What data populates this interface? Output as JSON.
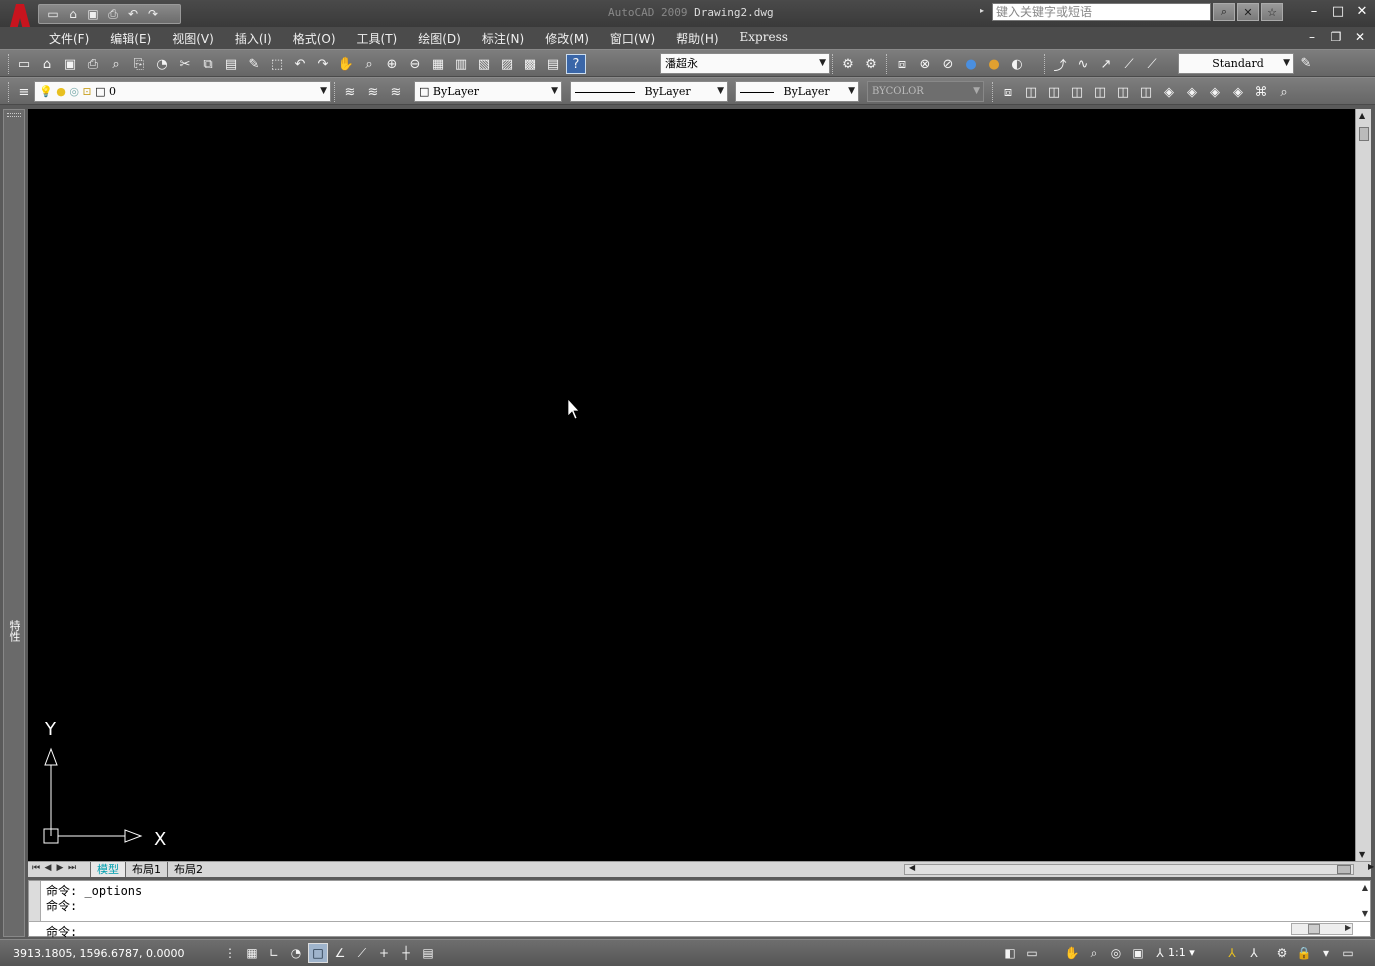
{
  "titlebar": {
    "app_name": "AutoCAD 2009",
    "doc_name": "Drawing2.dwg",
    "search_placeholder": "键入关键字或短语",
    "quick_access": [
      "new-icon",
      "open-icon",
      "save-icon",
      "plot-icon",
      "undo-icon",
      "redo-icon"
    ]
  },
  "menu": {
    "items": [
      "文件(F)",
      "编辑(E)",
      "视图(V)",
      "插入(I)",
      "格式(O)",
      "工具(T)",
      "绘图(D)",
      "标注(N)",
      "修改(M)",
      "窗口(W)",
      "帮助(H)"
    ],
    "express": "Express"
  },
  "toolbar1": {
    "text_style": "潘超永",
    "dim_style": "Standard"
  },
  "toolbar2": {
    "layer": "0",
    "color": "ByLayer",
    "linetype": "ByLayer",
    "lineweight": "ByLayer",
    "plotstyle": "BYCOLOR"
  },
  "palette": {
    "label": "特性"
  },
  "ucs": {
    "x_label": "X",
    "y_label": "Y"
  },
  "layout_tabs": {
    "tabs": [
      "模型",
      "布局1",
      "布局2"
    ],
    "active": 0
  },
  "command": {
    "lines": [
      "命令: _options",
      "命令:"
    ],
    "prompt": "命令:"
  },
  "status": {
    "coords": "3913.1805,  1596.6787,  0.0000",
    "scale": "1:1"
  },
  "colors": {
    "canvas": "#000000",
    "active_tab": "#00a0b0",
    "logo_red": "#c8141e"
  }
}
